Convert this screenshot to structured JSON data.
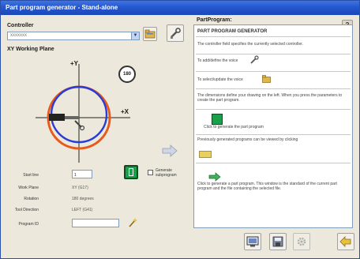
{
  "window": {
    "title": "Part program generator - Stand-alone"
  },
  "controller": {
    "label": "Controller",
    "selected": "xxxxxxx"
  },
  "work_plane": {
    "label": "XY Working Plane",
    "axis_y": "+Y",
    "axis_x": "+X",
    "rotate_label": "180"
  },
  "fields": {
    "start_line_label": "Start line",
    "start_line_value": "1",
    "work_plane_label": "Work Plane",
    "work_plane_value": "XY (G17)",
    "rotation_label": "Rotation",
    "rotation_value": "180 degrees",
    "tool_direction_label": "Tool Direction",
    "tool_direction_value": "LEFT (G41)",
    "program_id_label": "Program ID",
    "program_id_value": ""
  },
  "checkbox": {
    "label": "Generate subprogram"
  },
  "help": {
    "header": "PartProgram:",
    "title": "PART PROGRAM GENERATOR",
    "lines": [
      "The controller field specifies the currently selected controller.",
      "To add/define the voice",
      "To select/update the voice",
      "The dimensions define your drawing on the left. When you press the parameters to create the part program.",
      "Click to generate the part program",
      "Previously generated programs can be viewed by clicking",
      "Click to generate a part program. This window is the standard of the current part program and the file containing the selected file."
    ]
  },
  "colors": {
    "accent": "#2457d0",
    "circle_blue": "#2a3bd8",
    "circle_orange": "#e85a1c",
    "green": "#18a04a"
  }
}
